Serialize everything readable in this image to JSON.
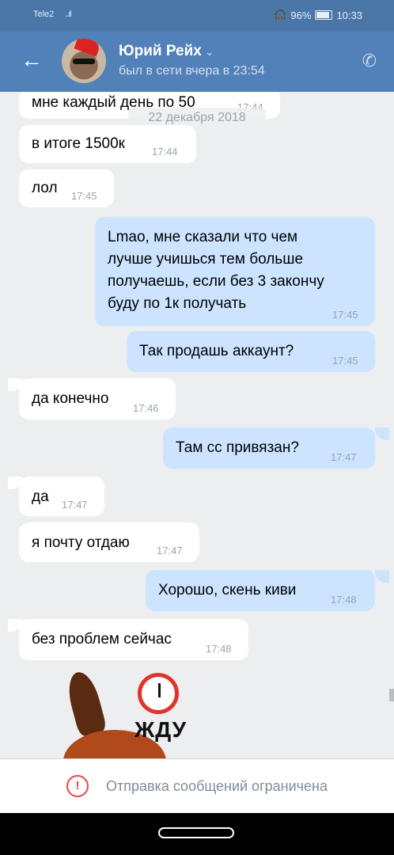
{
  "statusbar": {
    "carrier": "Tele2",
    "signal": "..ıl",
    "wifi_icon": "wifi-icon",
    "headphones": "🎧",
    "battery_pct": "96%",
    "time": "10:33"
  },
  "header": {
    "back_glyph": "←",
    "name": "Юрий Рейх",
    "chevron": "⌄",
    "status": "был в сети вчера в 23:54",
    "phone_glyph": "✆"
  },
  "date_badge": "22 декабря 2018",
  "messages": [
    {
      "text": "мне каждый день по 50",
      "time": "17:44"
    },
    {
      "text": "в итоге 1500к",
      "time": "17:44"
    },
    {
      "text": "лол",
      "time": "17:45"
    },
    {
      "text": "Lmao, мне сказали что чем лучше учишься тем больше получаешь, если без 3 закончу буду по 1к получать",
      "time": "17:45"
    },
    {
      "text": "Так продашь аккаунт?",
      "time": "17:45"
    },
    {
      "text": "да конечно",
      "time": "17:46"
    },
    {
      "text": "Там сс привязан?",
      "time": "17:47"
    },
    {
      "text": "да",
      "time": "17:47"
    },
    {
      "text": "я почту отдаю",
      "time": "17:47"
    },
    {
      "text": "Хорошо, скень киви",
      "time": "17:48"
    },
    {
      "text": "без проблем сейчас",
      "time": "17:48"
    }
  ],
  "sticker_text": "ЖДУ",
  "restriction": {
    "icon": "!",
    "text": "Отправка сообщений ограничена"
  },
  "colors": {
    "header": "#5181b8",
    "outgoing_bubble": "#cce4ff",
    "incoming_bubble": "#ffffff",
    "warning": "#e64646"
  }
}
